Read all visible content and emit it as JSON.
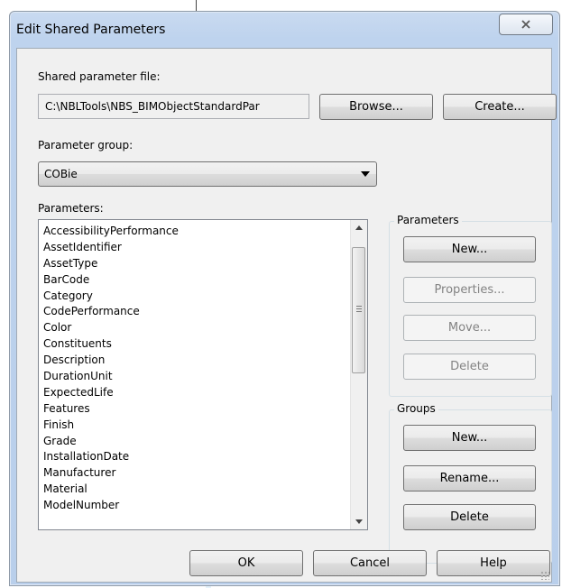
{
  "window": {
    "title": "Edit Shared Parameters"
  },
  "file_section": {
    "label": "Shared parameter file:",
    "path_value": "C:\\NBLTools\\NBS_BIMObjectStandardPar",
    "browse_label": "Browse...",
    "create_label": "Create..."
  },
  "group_section": {
    "label": "Parameter group:",
    "selected": "COBie"
  },
  "parameters_section": {
    "label": "Parameters:",
    "items": [
      "AccessibilityPerformance",
      "AssetIdentifier",
      "AssetType",
      "BarCode",
      "Category",
      "CodePerformance",
      "Color",
      "Constituents",
      "Description",
      "DurationUnit",
      "ExpectedLife",
      "Features",
      "Finish",
      "Grade",
      "InstallationDate",
      "Manufacturer",
      "Material",
      "ModelNumber"
    ]
  },
  "parameters_group": {
    "legend": "Parameters",
    "new_label": "New...",
    "properties_label": "Properties...",
    "move_label": "Move...",
    "delete_label": "Delete"
  },
  "groups_group": {
    "legend": "Groups",
    "new_label": "New...",
    "rename_label": "Rename...",
    "delete_label": "Delete"
  },
  "footer": {
    "ok_label": "OK",
    "cancel_label": "Cancel",
    "help_label": "Help"
  },
  "icons": {
    "close": "close-icon",
    "dropdown": "chevron-down-icon",
    "scroll_up": "scroll-up-icon",
    "scroll_down": "scroll-down-icon"
  }
}
